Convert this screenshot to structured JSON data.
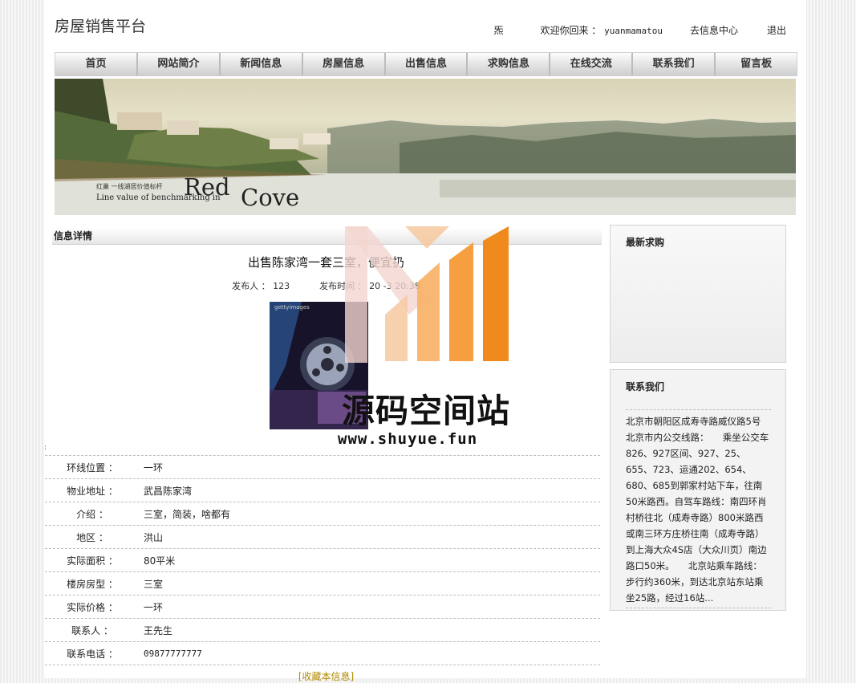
{
  "header": {
    "site_title": "房屋销售平台",
    "top_mark": "炁",
    "welcome_prefix": "欢迎你回来 ：",
    "username": "yuanmamatou",
    "info_center": "去信息中心",
    "logout": "退出"
  },
  "nav": [
    {
      "label": "首页"
    },
    {
      "label": "网站简介"
    },
    {
      "label": "新闻信息"
    },
    {
      "label": "房屋信息"
    },
    {
      "label": "出售信息"
    },
    {
      "label": "求购信息"
    },
    {
      "label": "在线交流"
    },
    {
      "label": "联系我们"
    },
    {
      "label": "留言板"
    }
  ],
  "banner": {
    "small_text": "红巢 一线湖居价值标杆",
    "subtitle": "Line value of benchmarking in",
    "word1": "Red",
    "word2": "Cove"
  },
  "main": {
    "section_title": "信息详情",
    "post_title": "出售陈家湾一套三室，便宜扔",
    "publisher_label": "发布人 ：",
    "publisher": "123",
    "time_label": "发布时间 ：",
    "time_value": "20 -3 20:38",
    "photo_tag": "gettyimages",
    "stray_mark": ":",
    "details": [
      {
        "label": "环线位置 ：",
        "value": "一环"
      },
      {
        "label": "物业地址 ：",
        "value": "武昌陈家湾"
      },
      {
        "label": "介绍 ：",
        "value": "三室，简装，啥都有"
      },
      {
        "label": "地区 ：",
        "value": "洪山"
      },
      {
        "label": "实际面积 ：",
        "value": "80平米"
      },
      {
        "label": "楼房房型 ：",
        "value": "三室"
      },
      {
        "label": "实际价格 ：",
        "value": "一环"
      },
      {
        "label": "联系人 ：",
        "value": "王先生"
      },
      {
        "label": "联系电话 ：",
        "value": "09877777777"
      }
    ],
    "favorite_link": "[收藏本信息]"
  },
  "sidebar": {
    "wanted_title": "最新求购",
    "contact_title": "联系我们",
    "contact_text": "北京市朝阳区成寿寺路威仪路5号　　北京市内公交线路：　　乘坐公交车826、927区间、927、25、655、723、运通202、654、680、685到郭家村站下车，往南50米路西。自驾车路线：南四环肖村桥往北（成寿寺路）800米路西或南三环方庄桥往南（成寿寺路）到上海大众4S店（大众川页）南边路口50米。　　北京站乘车路线：　　步行约360米，到达北京站东站乘坐25路，经过16站..."
  },
  "watermark": {
    "text": "源码空间站",
    "url": "www.shuyue.fun"
  }
}
